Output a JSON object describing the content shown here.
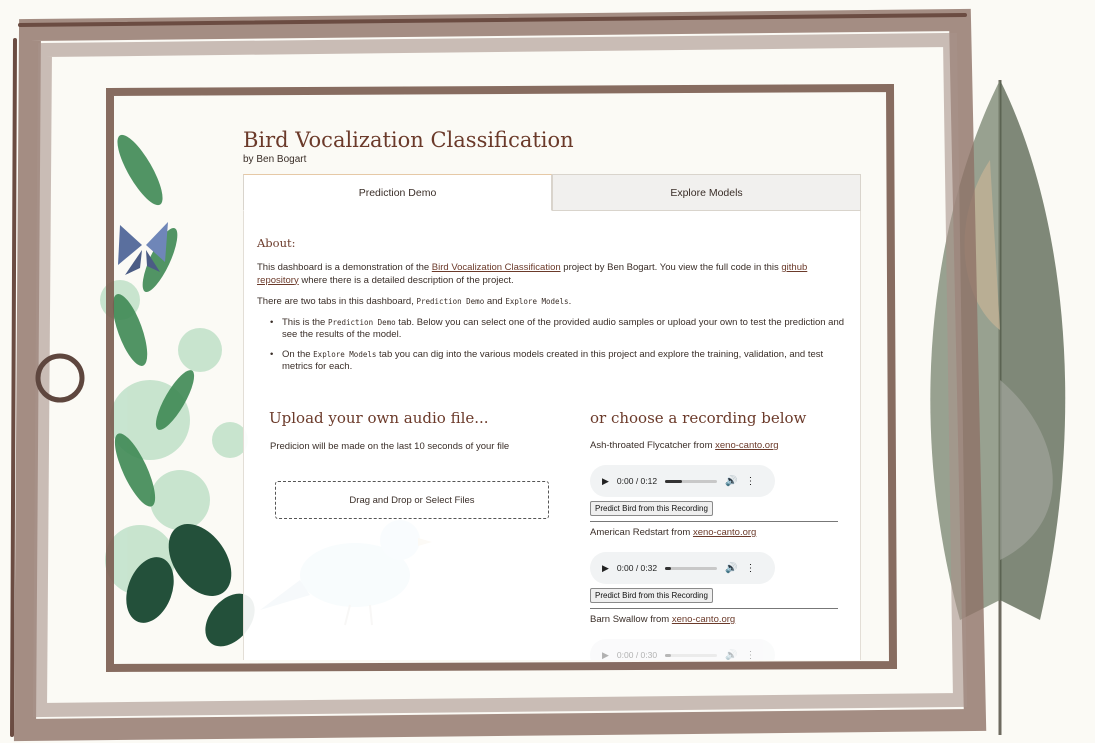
{
  "header": {
    "title": "Bird Vocalization Classification",
    "byline": "by Ben Bogart"
  },
  "tabs": [
    {
      "label": "Prediction Demo",
      "active": true
    },
    {
      "label": "Explore Models",
      "active": false
    }
  ],
  "about": {
    "heading": "About:",
    "p1_before": "This dashboard is a demonstration of the ",
    "p1_link": "Bird Vocalization Classification",
    "p1_middle": " project by Ben Bogart. You view the full code in this ",
    "p1_link2": "github repository",
    "p1_after": " where there is a detailed description of the project.",
    "p2_before": "There are two tabs in this dashboard, ",
    "p2_code1": "Prediction Demo",
    "p2_and": " and ",
    "p2_code2": "Explore Models",
    "p2_end": ".",
    "b1_before": "This is the ",
    "b1_code": "Prediction Demo",
    "b1_after": " tab. Below you can select one of the provided audio samples or upload your own to test the prediction and see the results of the model.",
    "b2_before": "On the ",
    "b2_code": "Explore Models",
    "b2_after": " tab you can dig into the various models created in this project and explore the training, validation, and test metrics for each."
  },
  "upload": {
    "heading": "Upload your own audio file...",
    "subtext": "Predicion will be made on the last 10 seconds of your file",
    "dropzone": "Drag and Drop or Select Files"
  },
  "recordings": {
    "heading": "or choose a recording below",
    "source": "xeno-canto.org",
    "button_label": "Predict Bird from this Recording",
    "items": [
      {
        "bird": "Ash-throated Flycatcher from ",
        "time": "0:00 / 0:12",
        "progress": 0.33
      },
      {
        "bird": "American Redstart from ",
        "time": "0:00 / 0:32",
        "progress": 0.12
      },
      {
        "bird": "Barn Swallow from ",
        "time": "0:00 / 0:30",
        "progress": 0.12
      }
    ]
  },
  "icons": {
    "play": "play-icon",
    "volume": "volume-icon",
    "more": "more-vert-icon"
  },
  "colors": {
    "accent": "#6b3a2a",
    "frame": "#7a5c50",
    "text": "#3a2e28"
  }
}
